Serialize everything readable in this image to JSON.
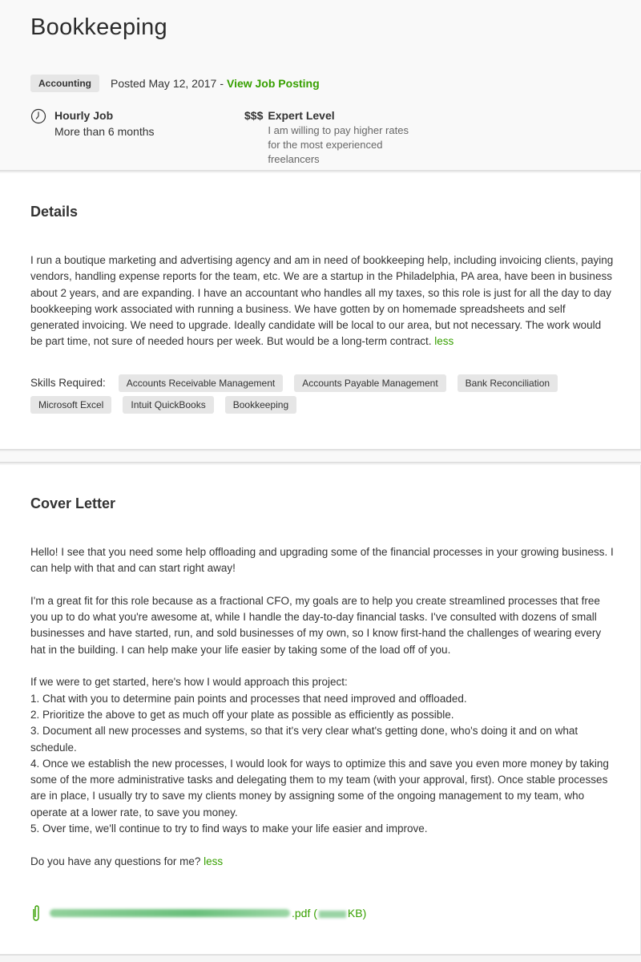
{
  "header": {
    "title": "Bookkeeping",
    "category": "Accounting",
    "posted": "Posted May 12, 2017",
    "separator": "-",
    "view_posting_link": "View Job Posting",
    "job_type": {
      "icon": "clock-icon",
      "title": "Hourly Job",
      "duration": "More than 6 months"
    },
    "level": {
      "icon_text": "$$$",
      "title": "Expert Level",
      "description": "I am willing to pay higher rates for the most experienced freelancers"
    }
  },
  "details": {
    "title": "Details",
    "body": "I run a boutique marketing and advertising agency and am in need of bookkeeping help, including invoicing clients, paying vendors, handling expense reports for the team, etc. We are a startup in the Philadelphia, PA area, have been in business about 2 years, and are expanding. I have an accountant who handles all my taxes, so this role is just for all the day to day bookkeeping work associated with running a business. We have gotten by on homemade spreadsheets and self generated invoicing. We need to upgrade. Ideally candidate will be local to our area, but not necessary. The work would be part time, not sure of needed hours per week. But would be a long-term contract.",
    "less_link": "less",
    "skills_label": "Skills Required:",
    "skills": [
      "Accounts Receivable Management",
      "Accounts Payable Management",
      "Bank Reconciliation",
      "Microsoft Excel",
      "Intuit QuickBooks",
      "Bookkeeping"
    ]
  },
  "cover_letter": {
    "title": "Cover Letter",
    "paragraphs": [
      "Hello! I see that you need some help offloading and upgrading some of the financial processes in your growing business. I can help with that and can start right away!",
      "I'm a great fit for this role because as a fractional CFO, my goals are to help you create streamlined processes that free you up to do what you're awesome at, while I handle the day-to-day financial tasks. I've consulted with dozens of small businesses and have started, run, and sold businesses of my own, so I know first-hand the challenges of wearing every hat in the building. I can help make your life easier by taking some of the load off of you."
    ],
    "approach_intro": "If we were to get started, here's how I would approach this project:",
    "approach_steps": [
      "1. Chat with you to determine pain points and processes that need improved and offloaded.",
      "2. Prioritize the above to get as much off your plate as possible as efficiently as possible.",
      "3. Document all new processes and systems, so that it's very clear what's getting done, who's doing it and on what schedule.",
      "4. Once we establish the new processes, I would look for ways to optimize this and save you even more money by taking some of the more administrative tasks and delegating them to my team (with your approval, first). Once stable processes are in place, I usually try to save my clients money by assigning some of the ongoing management to my team, who operate at a lower rate, to save you money.",
      "5. Over time, we'll continue to try to find ways to make your life easier and improve."
    ],
    "closing": "Do you have any questions for me?",
    "less_link": "less",
    "attachment": {
      "icon": "paperclip-icon",
      "extension": ".pdf (",
      "size_suffix": "KB)"
    }
  },
  "colors": {
    "accent_green": "#37a000",
    "badge_bg": "#e6e6e6"
  }
}
